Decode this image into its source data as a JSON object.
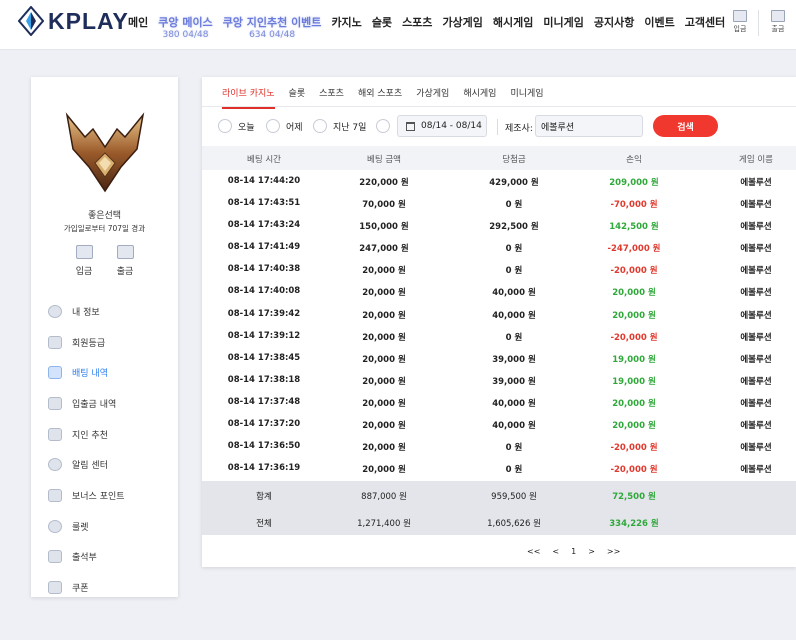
{
  "brand": {
    "logo_text": "KPLAY"
  },
  "nav": {
    "items": [
      {
        "label": "메인"
      },
      {
        "label": "쿠앙 메이스",
        "sub": "380 04/48",
        "promo": true
      },
      {
        "label": "쿠앙 지인추천 이벤트",
        "sub": "634 04/48",
        "promo": true
      },
      {
        "label": "카지노"
      },
      {
        "label": "슬롯"
      },
      {
        "label": "스포츠"
      },
      {
        "label": "가상게임"
      },
      {
        "label": "해시게임"
      },
      {
        "label": "미니게임"
      },
      {
        "label": "공지사항"
      },
      {
        "label": "이벤트"
      },
      {
        "label": "고객센터"
      }
    ],
    "deposit_label": "입금",
    "withdraw_label": "출금"
  },
  "sidebar": {
    "user_name": "좋은선택",
    "user_sub": "가입일로부터 707일 경과",
    "deposit_label": "입금",
    "withdraw_label": "출금",
    "menu": [
      {
        "label": "내 정보",
        "icon": "user-icon"
      },
      {
        "label": "회원등급",
        "icon": "grade-icon"
      },
      {
        "label": "배팅 내역",
        "icon": "betting-history-icon",
        "active": true
      },
      {
        "label": "입출금 내역",
        "icon": "transaction-icon"
      },
      {
        "label": "지인 추천",
        "icon": "referral-icon"
      },
      {
        "label": "알림 센터",
        "icon": "notification-icon"
      },
      {
        "label": "보너스 포인트",
        "icon": "bonus-icon"
      },
      {
        "label": "룰렛",
        "icon": "roulette-icon"
      },
      {
        "label": "출석부",
        "icon": "attendance-icon"
      },
      {
        "label": "쿠폰",
        "icon": "coupon-icon"
      }
    ]
  },
  "tabs": [
    {
      "label": "라이브 카지노",
      "active": true
    },
    {
      "label": "슬롯"
    },
    {
      "label": "스포츠"
    },
    {
      "label": "해외 스포츠"
    },
    {
      "label": "가상게임"
    },
    {
      "label": "해시게임"
    },
    {
      "label": "미니게임"
    }
  ],
  "filter": {
    "today": "오늘",
    "yesterday": "어제",
    "last7": "지난 7일",
    "date_range": "08/14 - 08/14",
    "provider_label": "제조사:",
    "provider_value": "에볼루션",
    "search_label": "검색"
  },
  "table": {
    "headers": [
      "베팅 시간",
      "베팅 금액",
      "당첨금",
      "손익",
      "게임 이름"
    ],
    "rows": [
      {
        "time": "08-14 17:44:20",
        "bet": "220,000 원",
        "win": "429,000 원",
        "pl": "209,000 원",
        "sign": "pos",
        "game": "에볼루션"
      },
      {
        "time": "08-14 17:43:51",
        "bet": "70,000 원",
        "win": "0 원",
        "pl": "-70,000 원",
        "sign": "neg",
        "game": "에볼루션"
      },
      {
        "time": "08-14 17:43:24",
        "bet": "150,000 원",
        "win": "292,500 원",
        "pl": "142,500 원",
        "sign": "pos",
        "game": "에볼루션"
      },
      {
        "time": "08-14 17:41:49",
        "bet": "247,000 원",
        "win": "0 원",
        "pl": "-247,000 원",
        "sign": "neg",
        "game": "에볼루션"
      },
      {
        "time": "08-14 17:40:38",
        "bet": "20,000 원",
        "win": "0 원",
        "pl": "-20,000 원",
        "sign": "neg",
        "game": "에볼루션"
      },
      {
        "time": "08-14 17:40:08",
        "bet": "20,000 원",
        "win": "40,000 원",
        "pl": "20,000 원",
        "sign": "pos",
        "game": "에볼루션"
      },
      {
        "time": "08-14 17:39:42",
        "bet": "20,000 원",
        "win": "40,000 원",
        "pl": "20,000 원",
        "sign": "pos",
        "game": "에볼루션"
      },
      {
        "time": "08-14 17:39:12",
        "bet": "20,000 원",
        "win": "0 원",
        "pl": "-20,000 원",
        "sign": "neg",
        "game": "에볼루션"
      },
      {
        "time": "08-14 17:38:45",
        "bet": "20,000 원",
        "win": "39,000 원",
        "pl": "19,000 원",
        "sign": "pos",
        "game": "에볼루션"
      },
      {
        "time": "08-14 17:38:18",
        "bet": "20,000 원",
        "win": "39,000 원",
        "pl": "19,000 원",
        "sign": "pos",
        "game": "에볼루션"
      },
      {
        "time": "08-14 17:37:48",
        "bet": "20,000 원",
        "win": "40,000 원",
        "pl": "20,000 원",
        "sign": "pos",
        "game": "에볼루션"
      },
      {
        "time": "08-14 17:37:20",
        "bet": "20,000 원",
        "win": "40,000 원",
        "pl": "20,000 원",
        "sign": "pos",
        "game": "에볼루션"
      },
      {
        "time": "08-14 17:36:50",
        "bet": "20,000 원",
        "win": "0 원",
        "pl": "-20,000 원",
        "sign": "neg",
        "game": "에볼루션"
      },
      {
        "time": "08-14 17:36:19",
        "bet": "20,000 원",
        "win": "0 원",
        "pl": "-20,000 원",
        "sign": "neg",
        "game": "에볼루션"
      }
    ],
    "subtotal": {
      "label": "합계",
      "bet": "887,000 원",
      "win": "959,500 원",
      "pl": "72,500 원"
    },
    "total": {
      "label": "전체",
      "bet": "1,271,400 원",
      "win": "1,605,626 원",
      "pl": "334,226 원"
    }
  },
  "pager": {
    "first": "<<",
    "prev": "<",
    "current": "1",
    "next": ">",
    "last": ">>"
  },
  "colors": {
    "accent_red": "#f0382e",
    "positive": "#2fa83a",
    "negative": "#e03a2e",
    "active_menu": "#2d7ff0"
  }
}
